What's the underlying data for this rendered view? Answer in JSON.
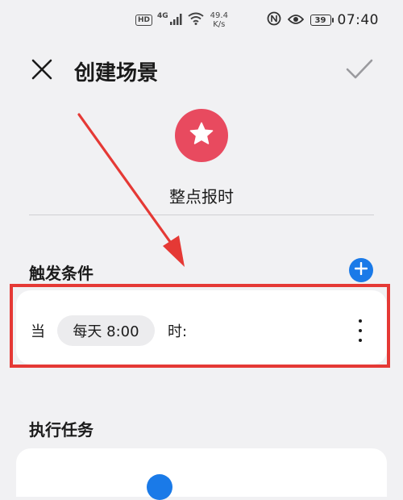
{
  "status_bar": {
    "hd": "HD",
    "network": "4G",
    "speed_value": "49.4",
    "speed_unit": "K/s",
    "battery": "39",
    "time": "07:40"
  },
  "header": {
    "title": "创建场景",
    "close_icon": "close-icon",
    "confirm_icon": "check-icon"
  },
  "scene": {
    "icon": "star-icon",
    "icon_color": "#e84a5f",
    "name": "整点报时"
  },
  "trigger": {
    "section_title": "触发条件",
    "when_label": "当",
    "time_chip": "每天 8:00",
    "time_suffix": "时:",
    "add_icon": "plus-icon",
    "more_icon": "more-vertical-icon"
  },
  "tasks": {
    "section_title": "执行任务"
  },
  "colors": {
    "accent": "#1a7ae8",
    "annotation": "#e53935",
    "background": "#f1f1f3"
  }
}
